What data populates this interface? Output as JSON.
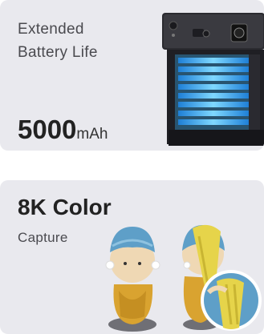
{
  "battery_card": {
    "title_line1": "Extended",
    "title_line2": "Battery Life",
    "value": "5000",
    "unit": "mAh"
  },
  "color_card": {
    "title": "8K Color",
    "subtitle": "Capture"
  },
  "colors": {
    "card_bg": "#e9e9ee",
    "text_primary": "#222222",
    "text_secondary": "#4a4a4f",
    "battery_glow": "#2fb8ff"
  }
}
